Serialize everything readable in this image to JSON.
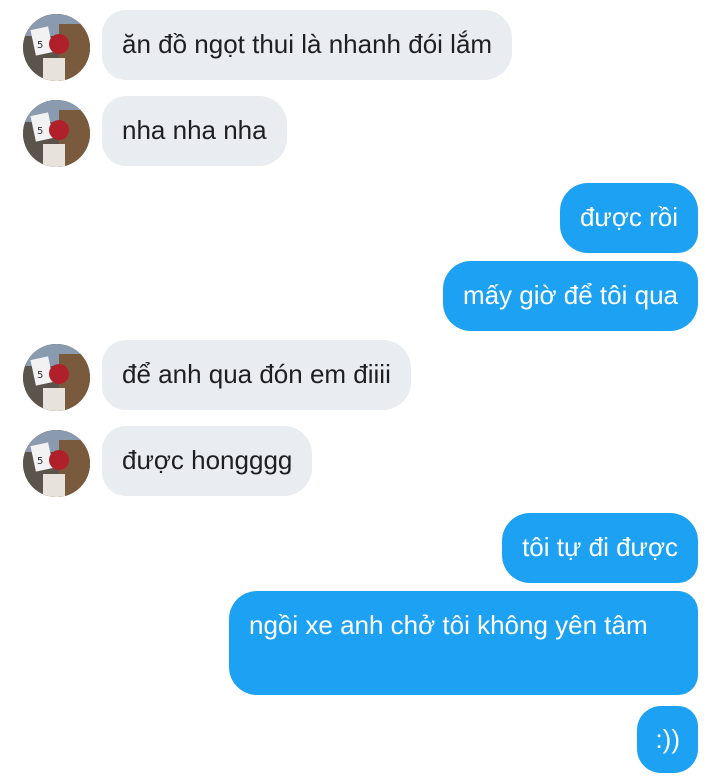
{
  "messages": [
    {
      "sender": "them",
      "text": "ăn đồ ngọt thui là nhanh đói lắm"
    },
    {
      "sender": "them",
      "text": "nha nha nha"
    },
    {
      "sender": "me",
      "text": "được rồi"
    },
    {
      "sender": "me",
      "text": "mấy giờ để tôi qua"
    },
    {
      "sender": "them",
      "text": "để anh qua đón em điiii"
    },
    {
      "sender": "them",
      "text": "được hongggg"
    },
    {
      "sender": "me",
      "text": "tôi tự đi được"
    },
    {
      "sender": "me",
      "text": "ngồi xe anh chở tôi không yên tâm"
    },
    {
      "sender": "me",
      "text": ":))"
    }
  ],
  "colors": {
    "incoming_bubble": "#e9ecf0",
    "outgoing_bubble": "#1da1f2",
    "incoming_text": "#1d1f22",
    "outgoing_text": "#ffffff"
  },
  "icons": {
    "contact_avatar": "avatar-photo-icon"
  }
}
